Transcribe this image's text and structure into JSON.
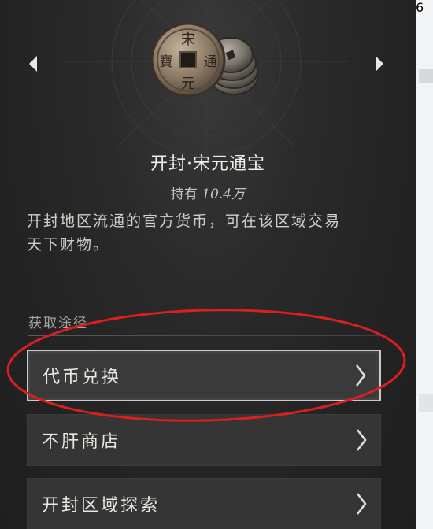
{
  "item": {
    "title": "开封·宋元通宝",
    "owned_prefix": "持有",
    "owned_value": "10.4万",
    "description_line1": "开封地区流通的官方货币，可在该区域交易",
    "description_line2": "天下财物。",
    "coin_characters": [
      "宋",
      "元",
      "通",
      "寶"
    ]
  },
  "acquire": {
    "label": "获取途径",
    "options": [
      {
        "label": "代币兑换",
        "highlighted": true
      },
      {
        "label": "不肝商店",
        "highlighted": false
      },
      {
        "label": "开封区域探索",
        "highlighted": false
      }
    ]
  },
  "side_glyph": "6",
  "colors": {
    "panel_bg": "#262626",
    "button_bg": "#353535",
    "highlight_border": "#c9c9c9",
    "annotation_red": "#d91f1f",
    "text_primary": "#f1eee7"
  }
}
